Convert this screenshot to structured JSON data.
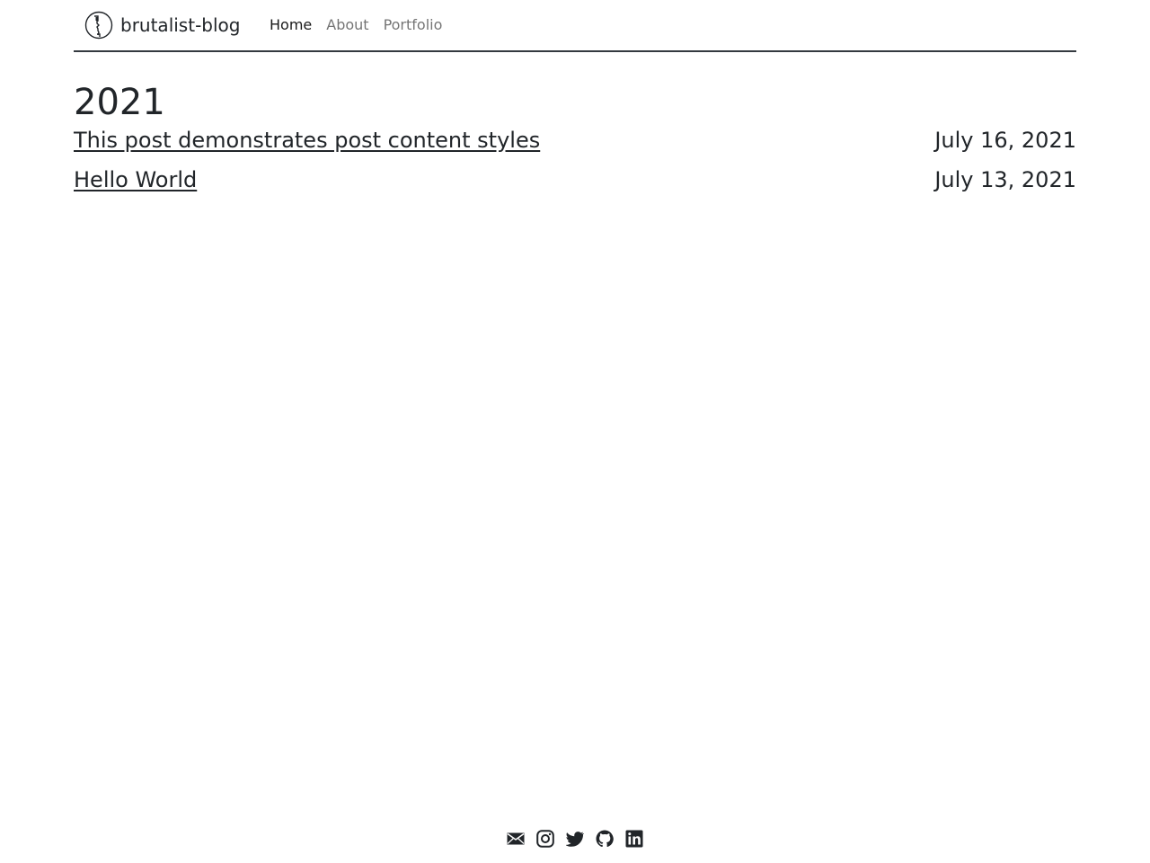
{
  "navbar": {
    "brand_name": "brutalist-blog",
    "brand_logo_icon": "face-profile-logo",
    "links": [
      {
        "label": "Home",
        "active": true
      },
      {
        "label": "About",
        "active": false
      },
      {
        "label": "Portfolio",
        "active": false
      }
    ]
  },
  "archive": {
    "year": "2021",
    "posts": [
      {
        "title": "This post demonstrates post content styles",
        "date": "July 16, 2021"
      },
      {
        "title": "Hello World",
        "date": "July 13, 2021"
      }
    ]
  },
  "footer": {
    "social_icons": [
      "email-icon",
      "instagram-icon",
      "twitter-icon",
      "github-icon",
      "linkedin-icon"
    ]
  },
  "colors": {
    "text": "#212529",
    "nav_inactive": "#7a7a7a",
    "divider": "#343a40",
    "background": "#ffffff"
  }
}
